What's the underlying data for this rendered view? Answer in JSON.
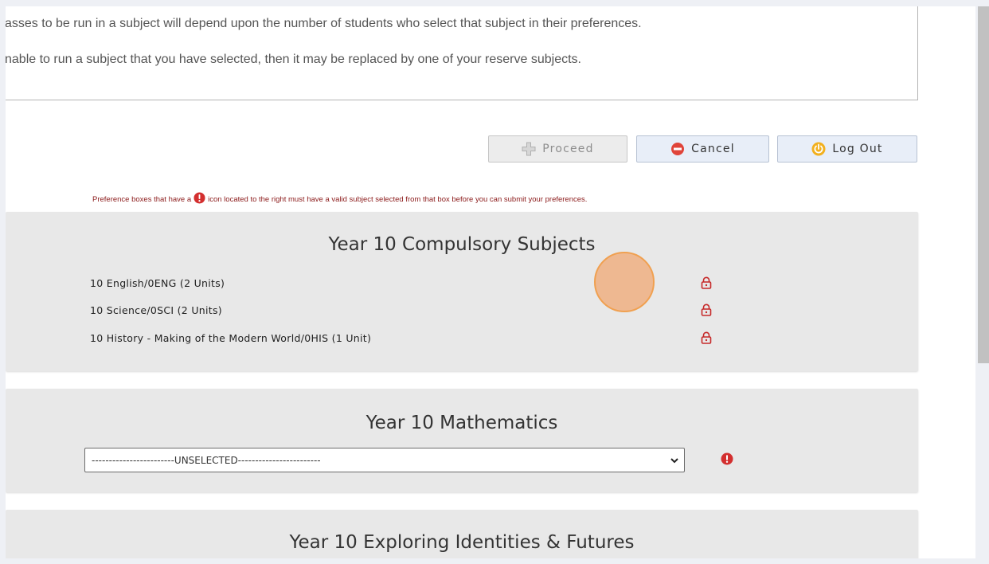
{
  "info": {
    "line1": "asses to be run in a subject will depend upon the number of students who select that subject in their preferences.",
    "line2": "nable to run a subject that you have selected, then it may be replaced by one of your reserve subjects."
  },
  "buttons": {
    "proceed": "Proceed",
    "cancel": "Cancel",
    "logout": "Log Out"
  },
  "notice": {
    "before": "Preference boxes that have a",
    "after": "icon located to the right must have a valid subject selected from that box before you can submit your preferences."
  },
  "panels": {
    "compulsory": {
      "title": "Year 10 Compulsory Subjects",
      "subjects": [
        "10 English/0ENG (2 Units)",
        "10 Science/0SCI (2 Units)",
        "10 History - Making of the Modern World/0HIS (1 Unit)"
      ]
    },
    "mathematics": {
      "title": "Year 10 Mathematics",
      "select_value": "------------------------UNSELECTED------------------------"
    },
    "identities": {
      "title": "Year 10 Exploring Identities & Futures"
    }
  },
  "icons": {
    "lock": "lock-icon",
    "alert": "alert-icon",
    "plus": "plus-icon",
    "cancel": "cancel-icon",
    "power": "power-icon"
  },
  "colors": {
    "alert_red": "#d32f2f",
    "notice_text": "#8b1a1a",
    "panel_bg": "#e8e8e8",
    "button_bg": "#e8eef8",
    "highlight": "#f0a050"
  }
}
